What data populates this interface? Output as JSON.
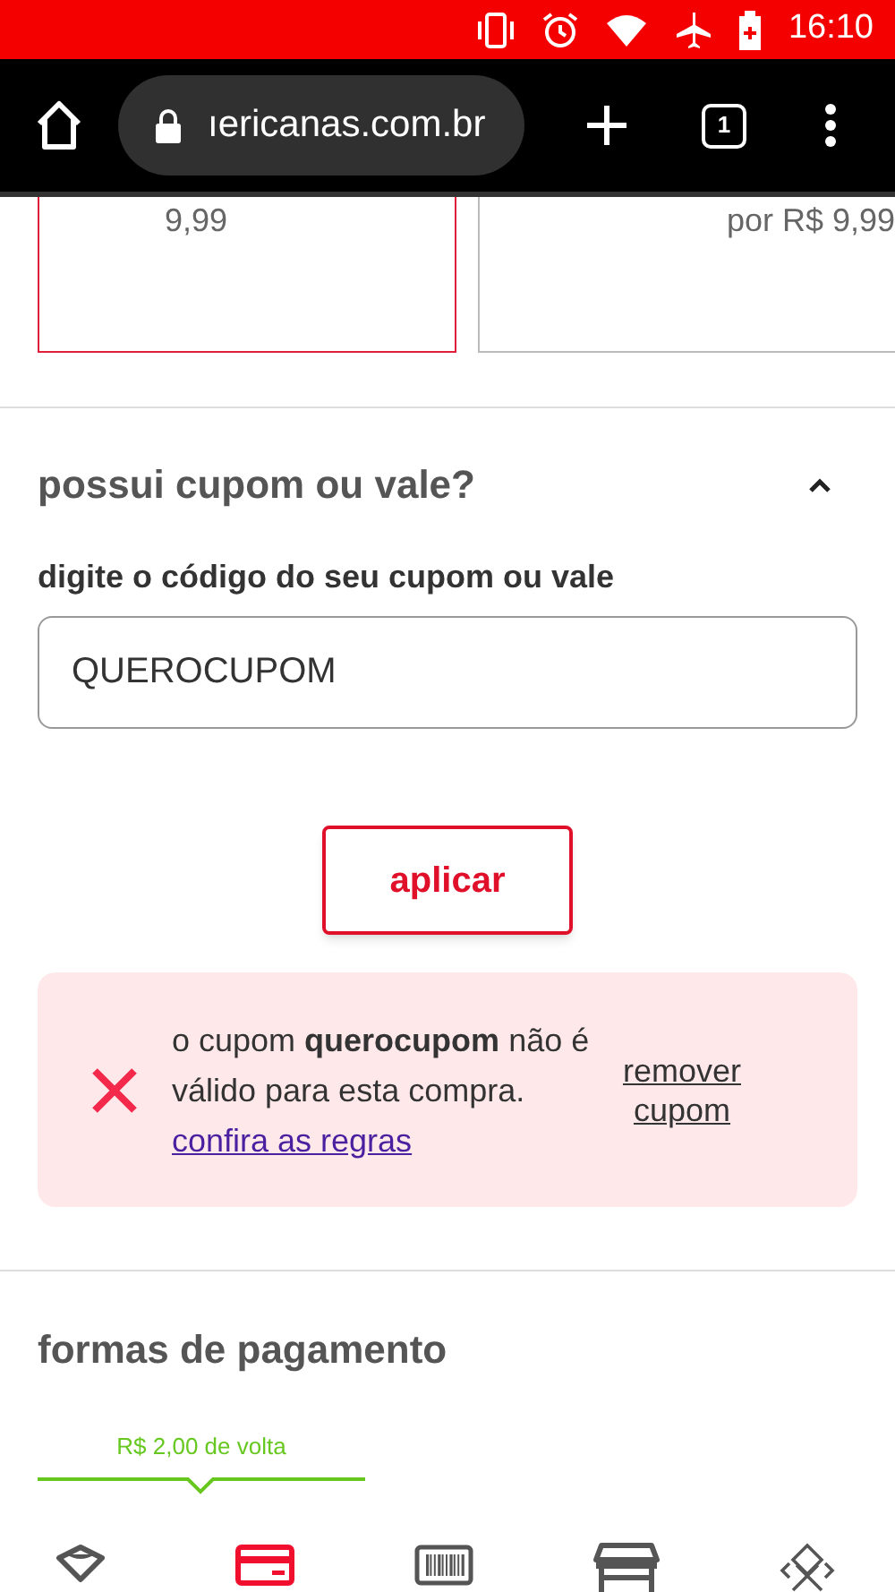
{
  "status_bar": {
    "time": "16:10"
  },
  "browser": {
    "url": "ıericanas.com.br",
    "tab_count": "1"
  },
  "offers": [
    {
      "price": "9,99",
      "selected": true
    },
    {
      "price": "por R$ 9,99",
      "selected": false
    }
  ],
  "coupon": {
    "title": "possui cupom ou vale?",
    "expanded": true,
    "label": "digite o código do seu cupom ou vale",
    "value": "QUEROCUPOM",
    "apply": "aplicar",
    "error": {
      "message": "o cupom **querocupom** não é válido para esta compra.",
      "link": "confira as regras",
      "remove": "remover cupom"
    }
  },
  "payment": {
    "title": "formas de pagamento",
    "cashback": "R$ 2,00 de volta",
    "methods": [
      {
        "kind": "wallet",
        "selected": false
      },
      {
        "kind": "card",
        "selected": true
      },
      {
        "kind": "barcode",
        "selected": false
      },
      {
        "kind": "store",
        "selected": false
      },
      {
        "kind": "pix",
        "selected": false
      }
    ]
  }
}
